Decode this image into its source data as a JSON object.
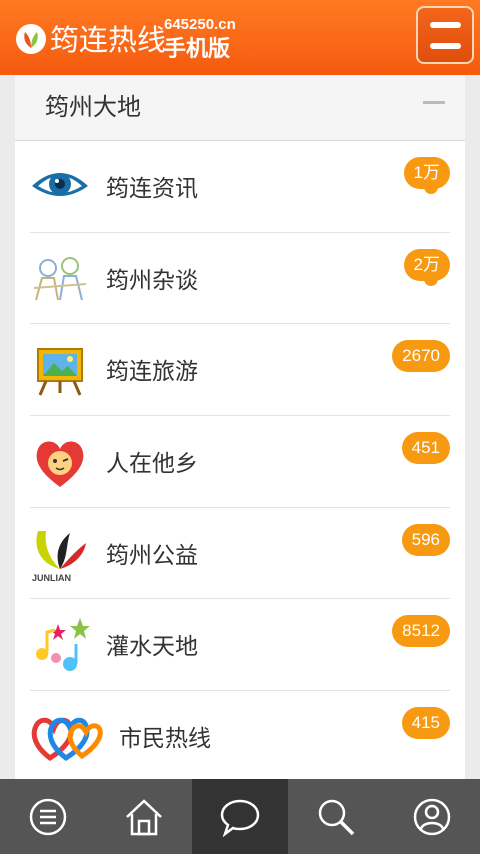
{
  "header": {
    "title": "筠连热线",
    "domain": "645250.cn",
    "subtitle": "手机版"
  },
  "section": {
    "title": "筠州大地"
  },
  "items": [
    {
      "label": "筠连资讯",
      "count": "1万",
      "icon": "eye-icon"
    },
    {
      "label": "筠州杂谈",
      "count": "2万",
      "icon": "people-icon"
    },
    {
      "label": "筠连旅游",
      "count": "2670",
      "icon": "easel-picture-icon"
    },
    {
      "label": "人在他乡",
      "count": "451",
      "icon": "heart-face-icon"
    },
    {
      "label": "筠州公益",
      "count": "596",
      "icon": "junlian-logo-icon"
    },
    {
      "label": "灌水天地",
      "count": "8512",
      "icon": "music-stars-icon"
    },
    {
      "label": "市民热线",
      "count": "415",
      "icon": "hearts-icon"
    }
  ],
  "logo_text": "JUNLIAN",
  "bottom_nav": [
    "menu-icon",
    "home-icon",
    "chat-icon",
    "search-icon",
    "user-icon"
  ],
  "colors": {
    "header": "#f55a0f",
    "badge": "#f79a12",
    "nav": "#555555",
    "nav_active": "#333333"
  }
}
